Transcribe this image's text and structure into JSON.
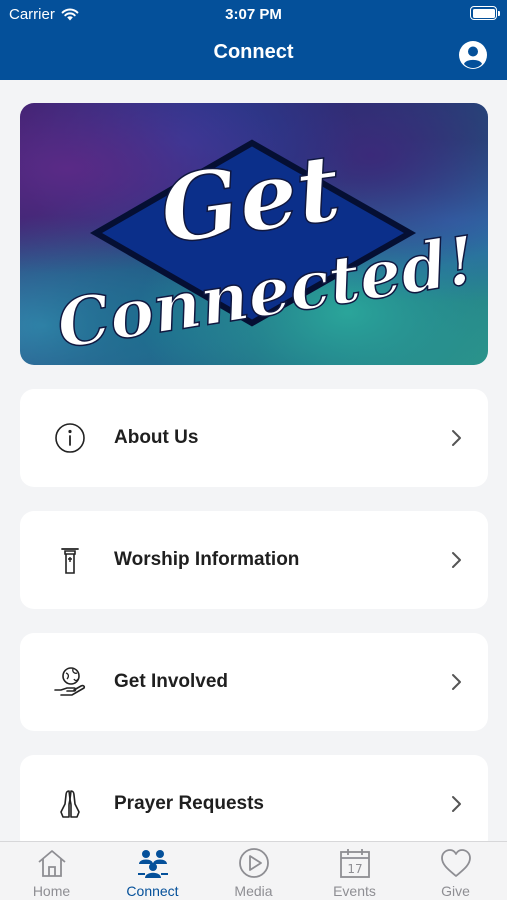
{
  "status_bar": {
    "carrier": "Carrier",
    "time": "3:07 PM"
  },
  "nav": {
    "title": "Connect"
  },
  "banner": {
    "line1": "Get",
    "line2": "Connected!"
  },
  "menu": [
    {
      "label": "About Us",
      "icon": "info-icon"
    },
    {
      "label": "Worship Information",
      "icon": "pulpit-icon"
    },
    {
      "label": "Get Involved",
      "icon": "globe-hand-icon"
    },
    {
      "label": "Prayer Requests",
      "icon": "praying-hands-icon"
    }
  ],
  "tabs": [
    {
      "label": "Home",
      "icon": "home-icon",
      "active": false
    },
    {
      "label": "Connect",
      "icon": "people-icon",
      "active": true
    },
    {
      "label": "Media",
      "icon": "play-icon",
      "active": false
    },
    {
      "label": "Events",
      "icon": "calendar-icon",
      "active": false,
      "calendar_day": "17"
    },
    {
      "label": "Give",
      "icon": "heart-icon",
      "active": false
    }
  ],
  "colors": {
    "brand": "#04509a",
    "background": "#f3f4f6",
    "tab_inactive": "#8e8e93"
  }
}
